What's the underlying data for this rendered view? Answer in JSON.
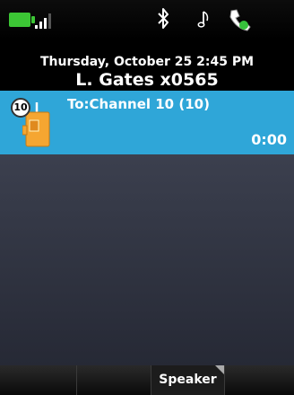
{
  "status_bar": {
    "icons": [
      "battery-icon",
      "signal-strength-icon",
      "bluetooth-icon",
      "music-note-icon",
      "handset-icon"
    ],
    "battery_color": "#3cc635"
  },
  "info": {
    "datetime": "Thursday, October 25 2:45 PM",
    "user": "L. Gates x0565"
  },
  "call": {
    "badge": "10",
    "target": "To:Channel 10 (10)",
    "timer": "0:00",
    "highlight_color": "#2fa6d8"
  },
  "softkeys": [
    "",
    "",
    "Speaker",
    ""
  ]
}
